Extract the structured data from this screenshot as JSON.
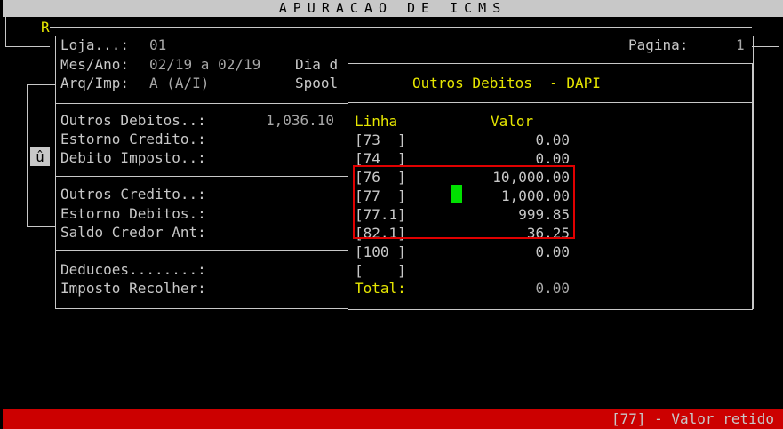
{
  "title": "APURACAO DE ICMS",
  "corner_marker": "R",
  "header": {
    "loja_label": "Loja...:",
    "loja_value": "01",
    "pagina_label": "Pagina:",
    "pagina_value": "1",
    "mesano_label": "Mes/Ano:",
    "mesano_value": "02/19 a 02/19",
    "dia_label": "Dia d",
    "arqimp_label": "Arq/Imp:",
    "arqimp_value": "A (A/I)",
    "spool_label": "Spool"
  },
  "form": {
    "outros_debitos_label": "Outros Debitos..:",
    "outros_debitos_value": "1,036.10",
    "estorno_credito_label": "Estorno Credito.:",
    "debito_imposto_label": "Debito Imposto..:",
    "outros_credito_label": "Outros Credito..:",
    "estorno_debitos_label": "Estorno Debitos.:",
    "saldo_credor_label": "Saldo Credor Ant:",
    "deducoes_label": "Deducoes........:",
    "imposto_recolher_label": "Imposto Recolher:"
  },
  "scroll_glyph": "û",
  "popup": {
    "title": "Outros Debitos  - DAPI",
    "col_linha": "Linha",
    "col_valor": "Valor",
    "rows": [
      {
        "code": "[73  ]",
        "value": "0.00"
      },
      {
        "code": "[74  ]",
        "value": "0.00"
      },
      {
        "code": "[76  ]",
        "value": "10,000.00"
      },
      {
        "code": "[77  ]",
        "value": "1,000.00"
      },
      {
        "code": "[77.1]",
        "value": "999.85"
      },
      {
        "code": "[82.1]",
        "value": "36.25"
      },
      {
        "code": "[100 ]",
        "value": "0.00"
      },
      {
        "code": "[    ]",
        "value": ""
      }
    ],
    "total_label": "Total:",
    "total_value": "0.00"
  },
  "status": "[77] - Valor retido",
  "colors": {
    "background": "#000000",
    "text": "#c8c8c8",
    "accent": "#e6e600",
    "highlight": "#e00000",
    "cursor": "#00e000",
    "status_bar": "#cc0000"
  }
}
